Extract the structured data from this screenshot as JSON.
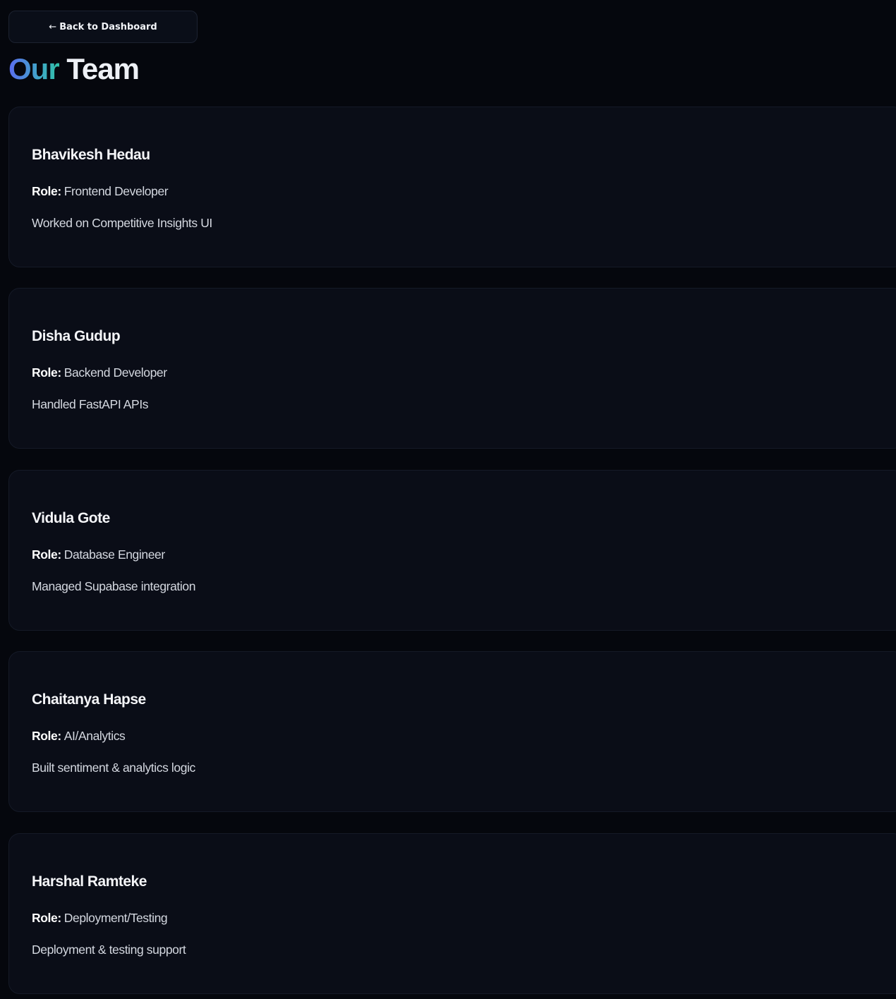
{
  "back_button": {
    "arrow": "←",
    "label": "Back to Dashboard"
  },
  "title": {
    "accent": "Our",
    "main": "Team"
  },
  "members": [
    {
      "name": "Bhavikesh Hedau",
      "role_label": "Role:",
      "role": "Frontend Developer",
      "description": "Worked on Competitive Insights UI"
    },
    {
      "name": "Disha Gudup",
      "role_label": "Role:",
      "role": "Backend Developer",
      "description": "Handled FastAPI APIs"
    },
    {
      "name": "Vidula Gote",
      "role_label": "Role:",
      "role": "Database Engineer",
      "description": "Managed Supabase integration"
    },
    {
      "name": "Chaitanya Hapse",
      "role_label": "Role:",
      "role": "AI/Analytics",
      "description": "Built sentiment & analytics logic"
    },
    {
      "name": "Harshal Ramteke",
      "role_label": "Role:",
      "role": "Deployment/Testing",
      "description": "Deployment & testing support"
    }
  ]
}
